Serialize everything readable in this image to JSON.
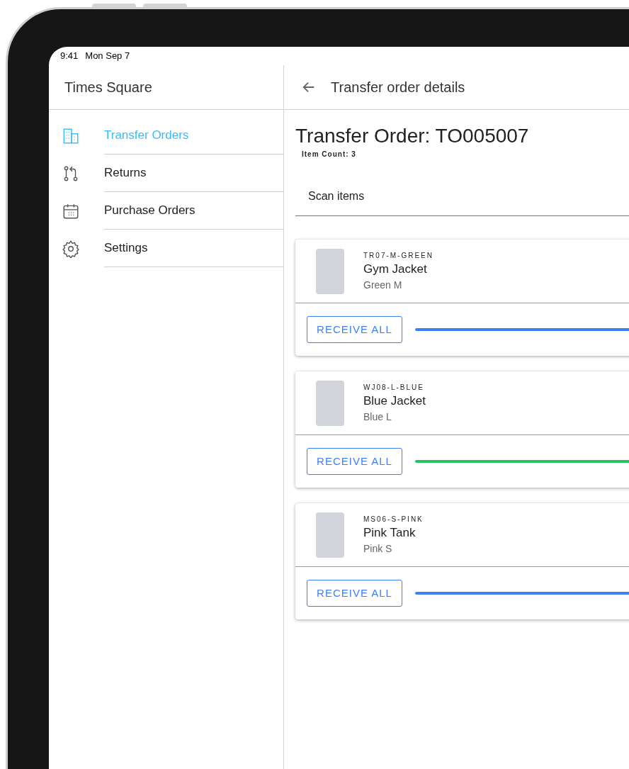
{
  "status_bar": {
    "time": "9:41",
    "date": "Mon Sep 7"
  },
  "sidebar": {
    "title": "Times Square",
    "items": [
      {
        "label": "Transfer Orders",
        "selected": true
      },
      {
        "label": "Returns",
        "selected": false
      },
      {
        "label": "Purchase Orders",
        "selected": false
      },
      {
        "label": "Settings",
        "selected": false
      }
    ]
  },
  "header": {
    "title": "Transfer order details"
  },
  "order": {
    "title": "Transfer Order: TO005007",
    "item_count": "Item Count: 3"
  },
  "scan": {
    "placeholder": "Scan items"
  },
  "items": [
    {
      "sku": "TR07-M-GREEN",
      "name": "Gym Jacket",
      "variant": "Green M",
      "button": "RECEIVE ALL",
      "color": "#3b82f6"
    },
    {
      "sku": "WJ08-L-BLUE",
      "name": "Blue Jacket",
      "variant": "Blue L",
      "button": "RECEIVE ALL",
      "color": "#22c55e"
    },
    {
      "sku": "MS06-S-PINK",
      "name": "Pink Tank",
      "variant": "Pink S",
      "button": "RECEIVE ALL",
      "color": "#3b82f6"
    }
  ]
}
